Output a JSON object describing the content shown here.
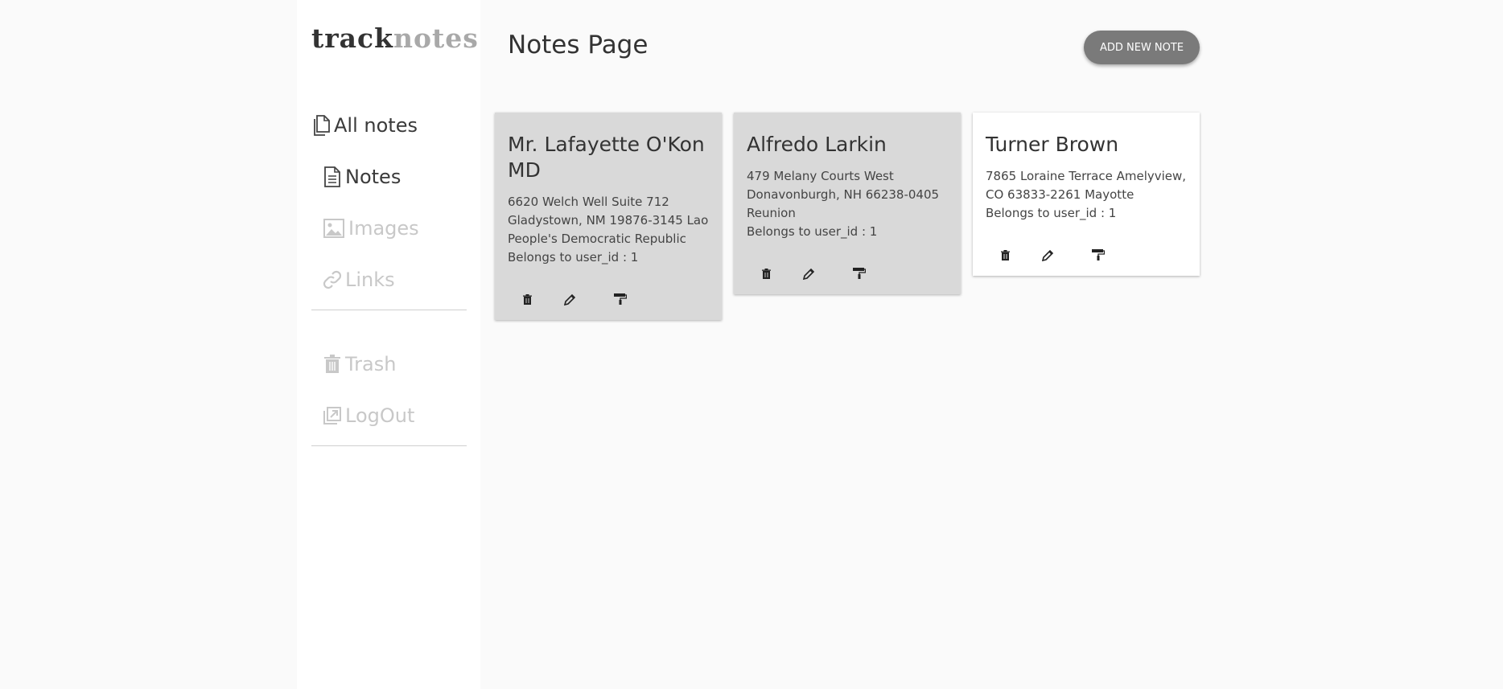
{
  "logo": {
    "part1": "track",
    "part2": "notes"
  },
  "sidebar": {
    "items": [
      {
        "label": "All notes",
        "icon": "files-icon"
      },
      {
        "label": "Notes",
        "icon": "document-icon"
      },
      {
        "label": "Images",
        "icon": "image-icon"
      },
      {
        "label": "Links",
        "icon": "link-icon"
      }
    ],
    "secondary": [
      {
        "label": "Trash",
        "icon": "trash-icon"
      },
      {
        "label": "LogOut",
        "icon": "logout-icon"
      }
    ]
  },
  "header": {
    "title": "Notes Page",
    "add_button": "ADD NEW NOTE"
  },
  "notes": [
    {
      "title": "Mr. Lafayette O'Kon MD",
      "address": "6620 Welch Well Suite 712 Gladystown, NM 19876-3145 Lao People's Democratic Republic",
      "owner": "Belongs to user_id : 1",
      "color": "#d9d9d9"
    },
    {
      "title": "Alfredo Larkin",
      "address": "479 Melany Courts West Donavonburgh, NH 66238-0405 Reunion",
      "owner": "Belongs to user_id : 1",
      "color": "#d9d9d9"
    },
    {
      "title": "Turner Brown",
      "address": "7865 Loraine Terrace Amelyview, CO 63833-2261 Mayotte",
      "owner": "Belongs to user_id : 1",
      "color": "#ffffff"
    }
  ],
  "colors": {
    "active_text": "#3a3a3a",
    "muted_text": "#c8c8c8",
    "button_bg": "#7a7a7a"
  }
}
